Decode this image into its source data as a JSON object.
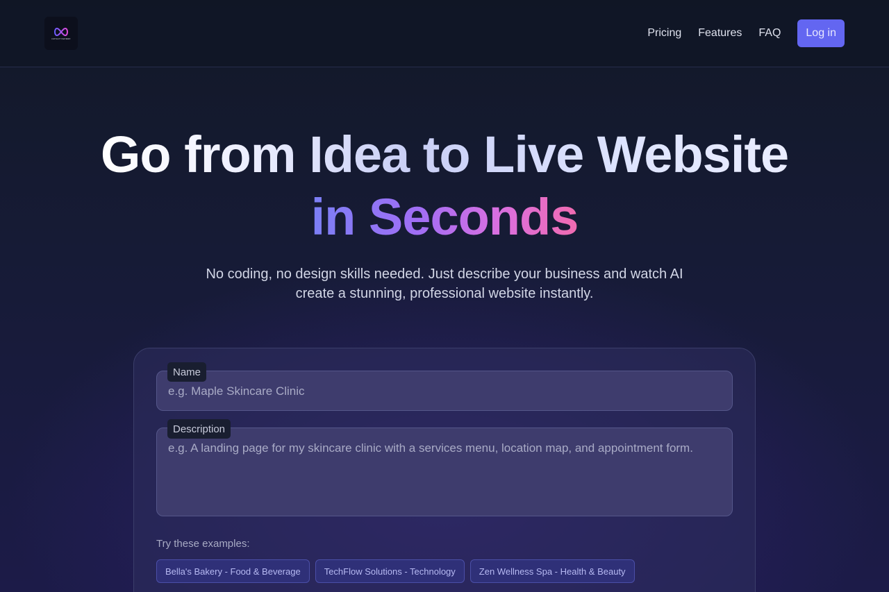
{
  "brand": {
    "logo_name": "infinity-logo",
    "logo_text": "INFINITYWEBBE",
    "colors": {
      "accent": "#6366f1",
      "gradient_start": "#7b7ff5",
      "gradient_end": "#f06bb0"
    }
  },
  "nav": {
    "links": [
      "Pricing",
      "Features",
      "FAQ"
    ],
    "login_label": "Log in"
  },
  "hero": {
    "title_line1": "Go from Idea to Live Website",
    "title_line2": "in Seconds",
    "subtitle_line1": "No coding, no design skills needed. Just describe your business and watch AI",
    "subtitle_line2": "create a stunning, professional website instantly."
  },
  "form": {
    "name_label": "Name",
    "name_placeholder": "e.g. Maple Skincare Clinic",
    "name_value": "",
    "description_label": "Description",
    "description_placeholder": "e.g. A landing page for my skincare clinic with a services menu, location map, and appointment form.",
    "description_value": "",
    "examples_title": "Try these examples:",
    "examples": [
      "Bella's Bakery - Food & Beverage",
      "TechFlow Solutions - Technology",
      "Zen Wellness Spa - Health & Beauty"
    ]
  }
}
